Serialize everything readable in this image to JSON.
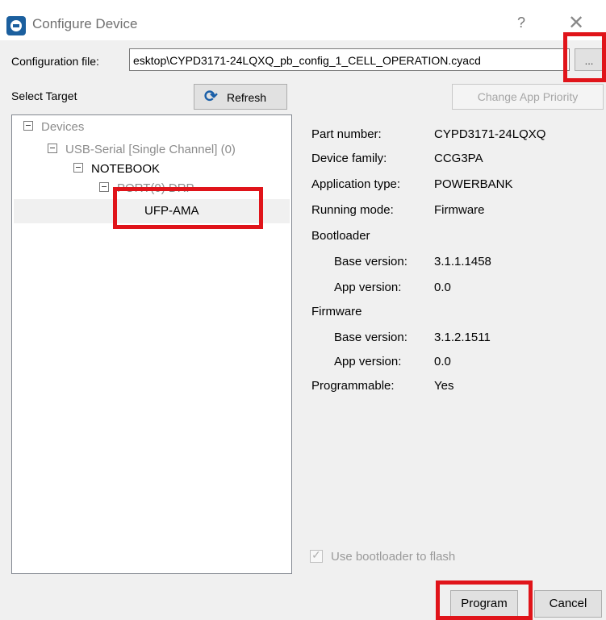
{
  "window": {
    "title": "Configure Device",
    "help": "?",
    "close": "✕"
  },
  "config": {
    "label": "Configuration file:",
    "value": "esktop\\CYPD3171-24LQXQ_pb_config_1_CELL_OPERATION.cyacd",
    "browse_label": "..."
  },
  "target": {
    "label": "Select Target",
    "refresh_label": "Refresh",
    "change_app_priority_label": "Change App Priority"
  },
  "tree": {
    "devices": "Devices",
    "usb_serial": "USB-Serial [Single Channel] (0)",
    "notebook": "NOTEBOOK",
    "port": "PORT(0) DRP",
    "ufp": "UFP-AMA"
  },
  "details": {
    "part_number_label": "Part number:",
    "part_number": "CYPD3171-24LQXQ",
    "device_family_label": "Device family:",
    "device_family": "CCG3PA",
    "application_type_label": "Application type:",
    "application_type": "POWERBANK",
    "running_mode_label": "Running mode:",
    "running_mode": "Firmware",
    "bootloader_label": "Bootloader",
    "bl_base_label": "Base version:",
    "bl_base": "3.1.1.1458",
    "bl_app_label": "App version:",
    "bl_app": "0.0",
    "firmware_label": "Firmware",
    "fw_base_label": "Base version:",
    "fw_base": "3.1.2.1511",
    "fw_app_label": "App version:",
    "fw_app": "0.0",
    "programmable_label": "Programmable:",
    "programmable": "Yes",
    "use_bootloader_label": "Use bootloader to flash"
  },
  "buttons": {
    "program": "Program",
    "cancel": "Cancel"
  },
  "colors": {
    "highlight": "#e0141a",
    "app_icon": "#1b5f9e"
  }
}
